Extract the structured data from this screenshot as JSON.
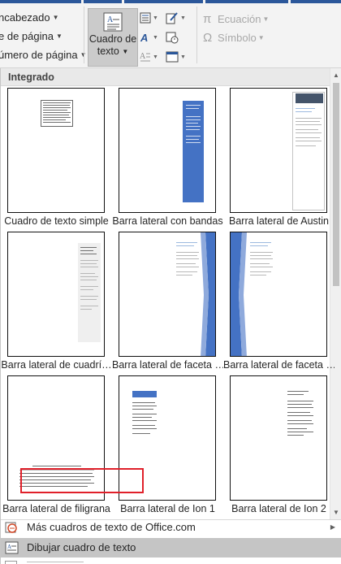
{
  "ribbon": {
    "header_items": [
      {
        "label": "ncabezado"
      },
      {
        "label": "e de página"
      },
      {
        "label": "úmero de página"
      }
    ],
    "text_box_button": {
      "line1": "Cuadro de",
      "line2": "texto"
    },
    "symbols": [
      {
        "glyph": "π",
        "label": "Ecuación"
      },
      {
        "glyph": "Ω",
        "label": "Símbolo"
      }
    ]
  },
  "gallery": {
    "section_title": "Integrado",
    "tiles": [
      {
        "label": "Cuadro de texto simple",
        "style": "simple"
      },
      {
        "label": "Barra lateral con bandas",
        "style": "bandas",
        "accent": "#4472c4"
      },
      {
        "label": "Barra lateral de Austin",
        "style": "austin",
        "accent": "#44546a"
      },
      {
        "label": "Barra lateral de cuadrí…",
        "style": "cuadricula"
      },
      {
        "label": "Barra lateral de faceta …",
        "style": "faceta-left",
        "accent": "#4472c4"
      },
      {
        "label": "Barra lateral de faceta …",
        "style": "faceta-right",
        "accent": "#4472c4"
      },
      {
        "label": "Barra lateral de filigrana",
        "style": "filigrana"
      },
      {
        "label": "Barra lateral de Ion 1",
        "style": "ion1",
        "accent": "#4472c4"
      },
      {
        "label": "Barra lateral de Ion 2",
        "style": "ion2"
      }
    ]
  },
  "menu": {
    "more_label": "Más cuadros de texto de Office.com",
    "draw_label": "Dibujar cuadro de texto"
  },
  "colors": {
    "accent_blue": "#4472c4",
    "highlight_box": "#e0202a",
    "title_bar": "#2b579a"
  }
}
